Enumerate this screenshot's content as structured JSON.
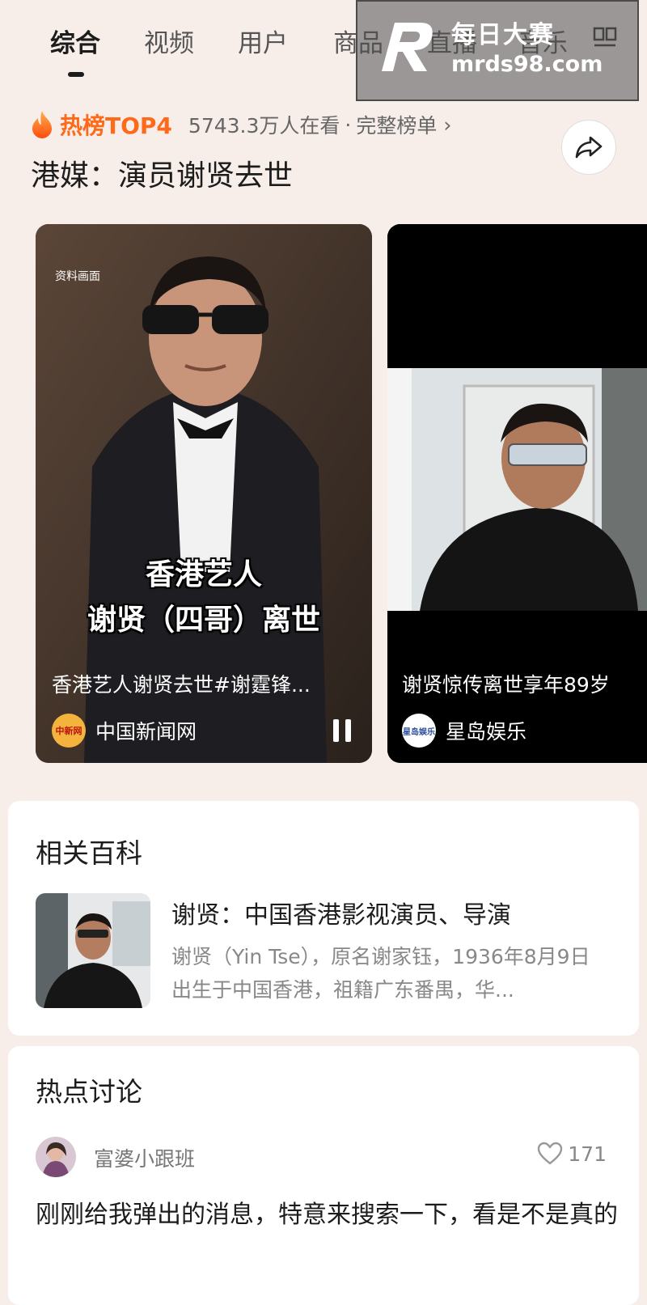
{
  "tabs": [
    {
      "label": "综合",
      "active": true
    },
    {
      "label": "视频"
    },
    {
      "label": "用户"
    },
    {
      "label": "商品"
    },
    {
      "label": "直播"
    },
    {
      "label": "音乐"
    }
  ],
  "watermark": {
    "line1": "每日大赛",
    "line2": "mrds98.com"
  },
  "hot": {
    "label": "热榜TOP4",
    "viewers": "5743.3万人在看",
    "separator": "·",
    "full_list": "完整榜单",
    "chevron": "›",
    "headline": "港媒：演员谢贤去世"
  },
  "videos": [
    {
      "tag": "资料画面",
      "overlay_line1": "香港艺人",
      "overlay_line2": "谢贤（四哥）离世",
      "caption": "香港艺人谢贤去世#谢霆锋...",
      "source": "中国新闻网",
      "source_logo": "中新网",
      "source_color": "#f3b33d"
    },
    {
      "caption": "谢贤惊传离世享年89岁",
      "source": "星岛娱乐",
      "source_logo": "星岛娱乐",
      "source_color": "#2a4d9b"
    }
  ],
  "baike": {
    "title": "相关百科",
    "entry_title": "谢贤：中国香港影视演员、导演",
    "entry_desc": "谢贤（Yin Tse），原名谢家钰，1936年8月9日出生于中国香港，祖籍广东番禺，华..."
  },
  "discussion": {
    "title": "热点讨论",
    "user": "富婆小跟班",
    "likes": "171",
    "text": "刚刚给我弹出的消息，特意来搜索一下，看是不是真的"
  },
  "colors": {
    "accent": "#ff6a1a",
    "background": "#f7eeea"
  },
  "icons": [
    "flame-icon",
    "share-icon",
    "pause-icon",
    "heart-icon",
    "grid-icon"
  ]
}
